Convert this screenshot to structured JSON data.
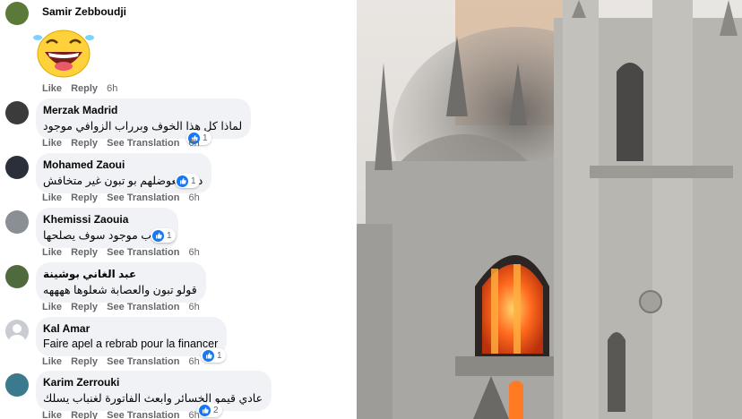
{
  "comments": [
    {
      "name": "Samir Zebboudji",
      "text": "",
      "like": "Like",
      "reply": "Reply",
      "time": "6h"
    },
    {
      "name": "Merzak Madrid",
      "text": "لماذا كل هذا الخوف وبرراب الزوافي موجود",
      "like": "Like",
      "reply": "Reply",
      "translate": "See Translation",
      "time": "6h",
      "reactions": "1"
    },
    {
      "name": "Mohamed Zaoui",
      "text": "درك يعوضلهم بو تبون غير متخافش",
      "like": "Like",
      "reply": "Reply",
      "translate": "See Translation",
      "time": "6h",
      "reactions": "1"
    },
    {
      "name": "Khemissi Zaouia",
      "text": "ربراب موجود سوف يصلحها",
      "like": "Like",
      "reply": "Reply",
      "translate": "See Translation",
      "time": "6h",
      "reactions": "1"
    },
    {
      "name": "عبد الغاني بوشينة",
      "text": "قولو تبون والعصابة شعلوها ههههه",
      "like": "Like",
      "reply": "Reply",
      "translate": "See Translation",
      "time": "6h"
    },
    {
      "name": "Kal Amar",
      "text": "Faire apel a rebrab pour la financer",
      "like": "Like",
      "reply": "Reply",
      "translate": "See Translation",
      "time": "6h",
      "reactions": "1"
    },
    {
      "name": "Karim Zerrouki",
      "text": "عادي قيمو الخسائر وابعث الفاتورة لغنباب يسلك",
      "like": "Like",
      "reply": "Reply",
      "translate": "See Translation",
      "time": "6h",
      "reactions": "2"
    }
  ],
  "colors": {
    "like_blue": "#1877f2",
    "bubble": "#f0f2f5",
    "meta": "#65676b",
    "fire": "#ff5a14"
  }
}
